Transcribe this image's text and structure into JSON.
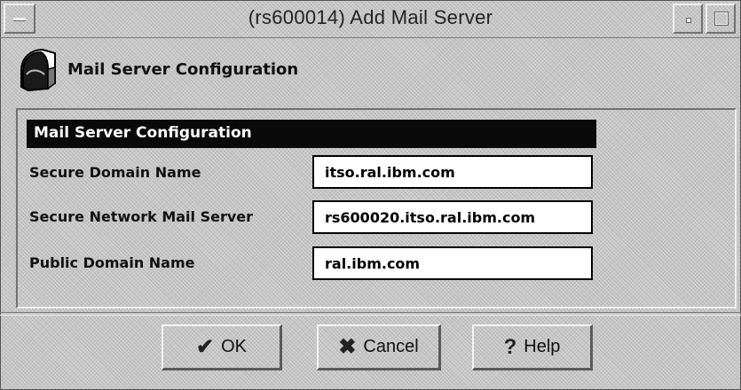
{
  "window": {
    "title": "(rs600014) Add Mail Server"
  },
  "header": {
    "label": "Mail Server Configuration",
    "icon": "mailbox-icon"
  },
  "section": {
    "title": "Mail Server Configuration"
  },
  "fields": [
    {
      "label": "Secure Domain Name",
      "value": "itso.ral.ibm.com"
    },
    {
      "label": "Secure Network Mail Server",
      "value": "rs600020.itso.ral.ibm.com"
    },
    {
      "label": "Public Domain Name",
      "value": "ral.ibm.com"
    }
  ],
  "buttons": {
    "ok": {
      "label": "OK",
      "icon": "checkmark-icon"
    },
    "cancel": {
      "label": "Cancel",
      "icon": "x-icon"
    },
    "help": {
      "label": "Help",
      "icon": "question-icon"
    }
  }
}
